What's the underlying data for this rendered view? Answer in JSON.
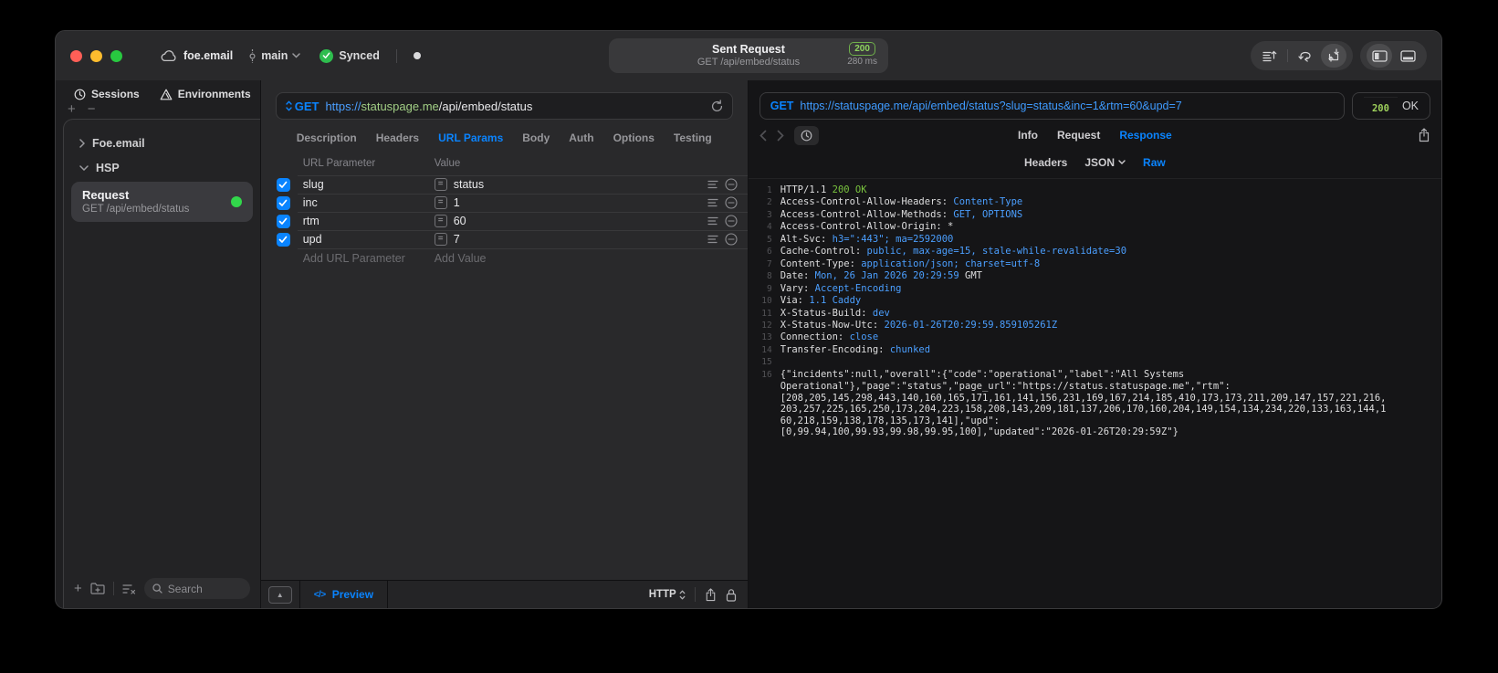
{
  "titlebar": {
    "project": "foe.email",
    "branch": "main",
    "sync_status": "Synced",
    "request_summary": {
      "title": "Sent Request",
      "method_path": "GET /api/embed/status",
      "status_code": "200",
      "duration": "280 ms"
    }
  },
  "sidebar": {
    "tabs": [
      {
        "label": "Sessions",
        "icon": "clock-icon"
      },
      {
        "label": "Environments",
        "icon": "environments-icon"
      }
    ],
    "tree": [
      {
        "label": "Foe.email",
        "expanded": false
      },
      {
        "label": "HSP",
        "expanded": true
      }
    ],
    "request_item": {
      "title": "Request",
      "subtitle": "GET /api/embed/status"
    },
    "search_placeholder": "Search"
  },
  "request_panel": {
    "method": "GET",
    "url": {
      "scheme": "https://",
      "host": "statuspage.me",
      "path": "/api/embed/status"
    },
    "tabs": [
      "Description",
      "Headers",
      "URL Params",
      "Body",
      "Auth",
      "Options",
      "Testing"
    ],
    "active_tab": "URL Params",
    "params": {
      "columns": [
        "URL Parameter",
        "Value"
      ],
      "rows": [
        {
          "enabled": true,
          "name": "slug",
          "value": "status"
        },
        {
          "enabled": true,
          "name": "inc",
          "value": "1"
        },
        {
          "enabled": true,
          "name": "rtm",
          "value": "60"
        },
        {
          "enabled": true,
          "name": "upd",
          "value": "7"
        }
      ],
      "add_param_placeholder": "Add URL Parameter",
      "add_value_placeholder": "Add Value"
    },
    "footer": {
      "preview_label": "Preview",
      "code_glyph": "</>",
      "protocol_selector": "HTTP"
    }
  },
  "response_panel": {
    "method": "GET",
    "url": "https://statuspage.me/api/embed/status?slug=status&inc=1&rtm=60&upd=7",
    "status_code": "200",
    "status_text": "OK",
    "tabs": [
      "Info",
      "Request",
      "Response"
    ],
    "active_tab": "Response",
    "subtabs": [
      "Headers",
      "JSON",
      "Raw"
    ],
    "active_subtab": "Raw",
    "status_line": {
      "protocol": "HTTP/1.1",
      "status": "200 OK"
    },
    "headers": [
      {
        "name": "Access-Control-Allow-Headers",
        "value": "Content-Type"
      },
      {
        "name": "Access-Control-Allow-Methods",
        "value": "GET, OPTIONS"
      },
      {
        "name": "Access-Control-Allow-Origin",
        "value": "",
        "plain": "*"
      },
      {
        "name": "Alt-Svc",
        "value": "h3=\":443\"; ma=2592000"
      },
      {
        "name": "Cache-Control",
        "value": "public, max-age=15, stale-while-revalidate=30"
      },
      {
        "name": "Content-Type",
        "value": "application/json; charset=utf-8"
      },
      {
        "name": "Date",
        "value": "Mon, 26 Jan 2026 20:29:59",
        "plain": " GMT"
      },
      {
        "name": "Vary",
        "value": "Accept-Encoding"
      },
      {
        "name": "Via",
        "value": "1.1 Caddy"
      },
      {
        "name": "X-Status-Build",
        "value": "dev"
      },
      {
        "name": "X-Status-Now-Utc",
        "value": "2026-01-26T20:29:59.859105261Z"
      },
      {
        "name": "Connection",
        "value": "close"
      },
      {
        "name": "Transfer-Encoding",
        "value": "chunked"
      }
    ],
    "body_lines": [
      "{\"incidents\":null,\"overall\":{\"code\":\"operational\",\"label\":\"All Systems",
      "Operational\"},\"page\":\"status\",\"page_url\":\"https://status.statuspage.me\",\"rtm\":",
      "[208,205,145,298,443,140,160,165,171,161,141,156,231,169,167,214,185,410,173,173,211,209,147,157,221,216,",
      "203,257,225,165,250,173,204,223,158,208,143,209,181,137,206,170,160,204,149,154,134,234,220,133,163,144,1",
      "60,218,159,138,178,135,173,141],\"upd\":",
      "[0,99.94,100,99.93,99.98,99.95,100],\"updated\":\"2026-01-26T20:29:59Z\"}"
    ]
  },
  "colors": {
    "accent_blue": "#0a84ff",
    "value_blue": "#4b9fff",
    "host_green": "#a2cf85",
    "status_green": "#79c33e",
    "success_dot_green": "#32d74b",
    "checkbox_blue": "#0a84ff"
  },
  "icons": [
    "cloud-icon",
    "git-branch-icon",
    "chevron-down-icon",
    "check-circle-icon",
    "record-dot-icon",
    "import-lines-icon",
    "merge-arrows-icon",
    "sync-box-icon",
    "panel-left-icon",
    "panel-bottom-icon",
    "clock-icon",
    "environments-icon",
    "chevron-right-icon",
    "plus-icon",
    "minus-icon",
    "folder-plus-icon",
    "filter-list-icon",
    "search-icon",
    "reload-icon",
    "method-stepper-icon",
    "equals-icon",
    "drag-lines-icon",
    "remove-circle-icon",
    "expand-triangle-icon",
    "code-icon",
    "updown-chevron-icon",
    "share-icon",
    "lock-icon",
    "back-chevron-icon",
    "forward-chevron-icon",
    "history-clock-icon"
  ]
}
